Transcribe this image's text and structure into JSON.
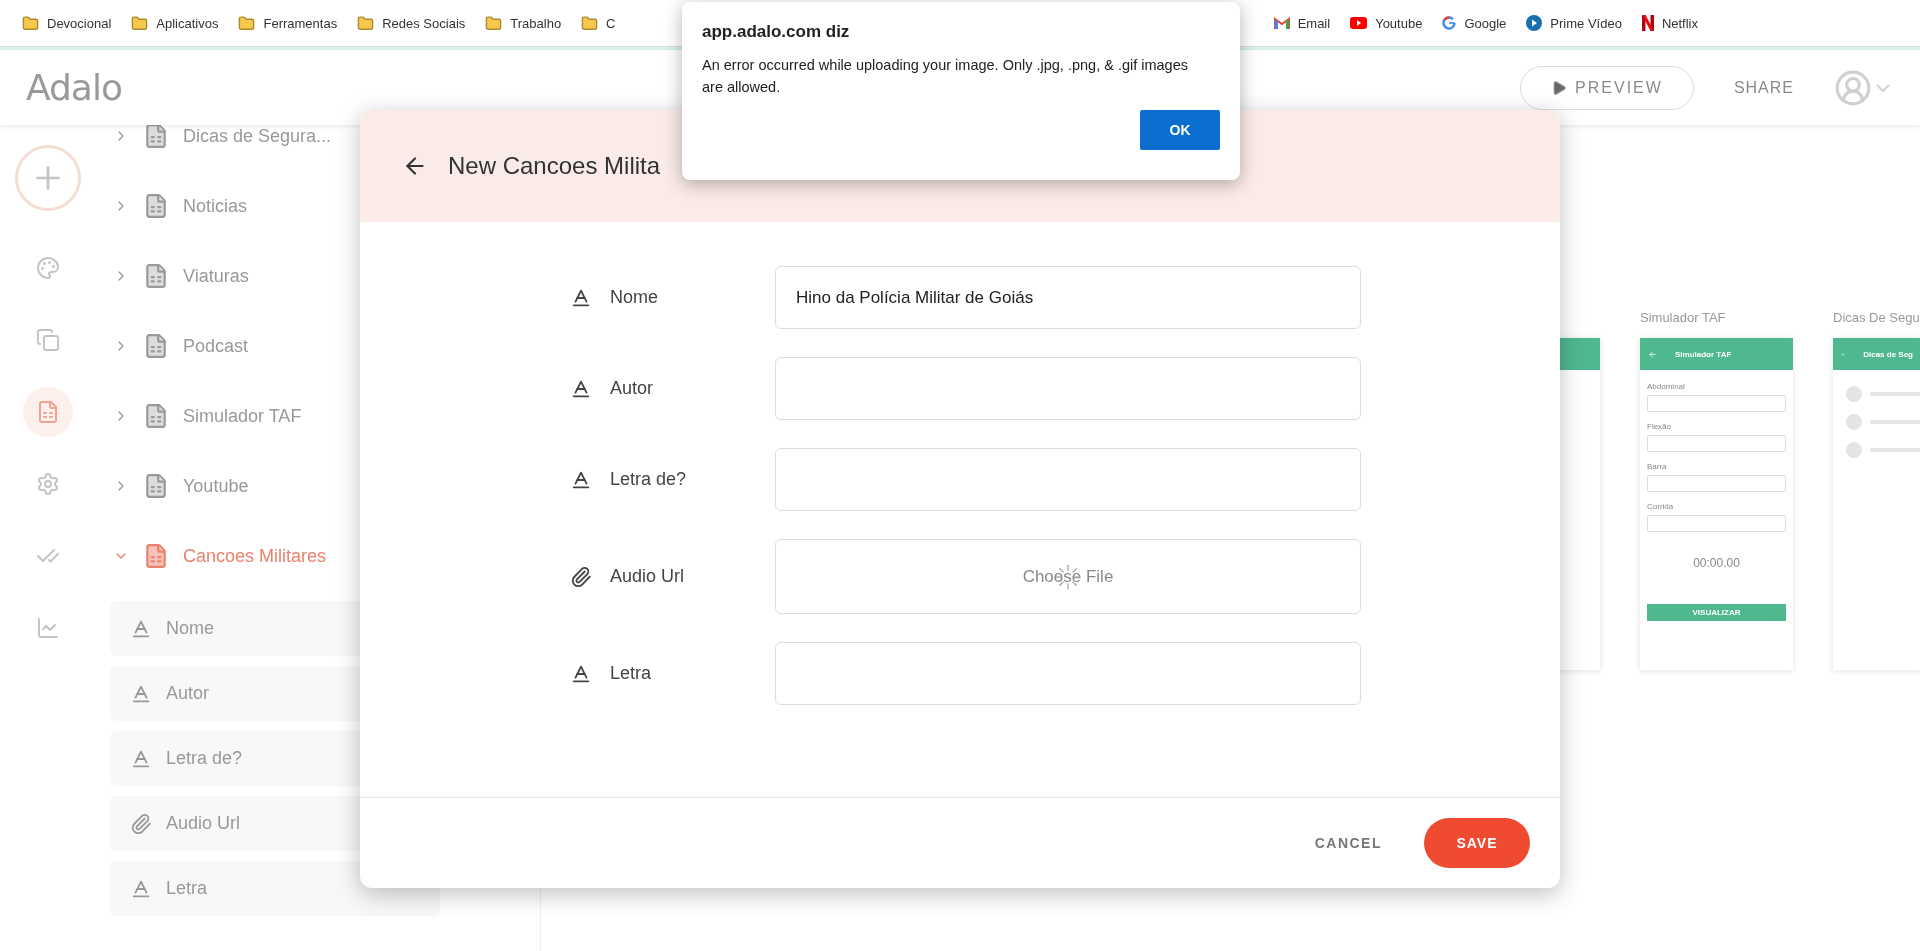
{
  "bookmarks": {
    "left": [
      {
        "label": "Devocional"
      },
      {
        "label": "Aplicativos"
      },
      {
        "label": "Ferramentas"
      },
      {
        "label": "Redes Sociais"
      },
      {
        "label": "Trabalho"
      },
      {
        "label": "C"
      }
    ],
    "right": [
      {
        "label": "Email",
        "kind": "gmail"
      },
      {
        "label": "Youtube",
        "kind": "youtube"
      },
      {
        "label": "Google",
        "kind": "google"
      },
      {
        "label": "Prime Vídeo",
        "kind": "prime"
      },
      {
        "label": "Netflix",
        "kind": "netflix"
      }
    ]
  },
  "app_header": {
    "logo": "Adalo",
    "preview": "PREVIEW",
    "share": "SHARE"
  },
  "rail": [
    {
      "kind": "add",
      "selected": false
    },
    {
      "kind": "palette",
      "selected": false
    },
    {
      "kind": "screens",
      "selected": false
    },
    {
      "kind": "database",
      "selected": true
    },
    {
      "kind": "settings",
      "selected": false
    },
    {
      "kind": "checks",
      "selected": false
    },
    {
      "kind": "analytics",
      "selected": false
    }
  ],
  "collections": [
    {
      "name": "Dicas de Segura...",
      "expanded": false
    },
    {
      "name": "Noticias",
      "expanded": false
    },
    {
      "name": "Viaturas",
      "expanded": false
    },
    {
      "name": "Podcast",
      "expanded": false
    },
    {
      "name": "Simulador TAF",
      "expanded": false
    },
    {
      "name": "Youtube",
      "expanded": false
    },
    {
      "name": "Cancoes Militares",
      "expanded": true,
      "children": [
        {
          "name": "Nome",
          "kind": "text"
        },
        {
          "name": "Autor",
          "kind": "text"
        },
        {
          "name": "Letra de?",
          "kind": "text"
        },
        {
          "name": "Audio Url",
          "kind": "file"
        },
        {
          "name": "Letra",
          "kind": "text"
        }
      ]
    }
  ],
  "canvas": {
    "screens": [
      {
        "kind": "blank"
      },
      {
        "kind": "form",
        "title": "Simulador TAF",
        "header": "Simulador TAF",
        "fields": [
          "Abdominal",
          "Flexão",
          "Barra",
          "Corrida"
        ],
        "timer": "00:00.00",
        "button": "VISUALIZAR"
      },
      {
        "kind": "list",
        "title": "Dicas De Segu",
        "header": "Dicas de Seg"
      }
    ]
  },
  "modal": {
    "title": "New Cancoes Milita",
    "fields": [
      {
        "label": "Nome",
        "kind": "text",
        "value": "Hino da Polícia Militar de Goiás"
      },
      {
        "label": "Autor",
        "kind": "text"
      },
      {
        "label": "Letra de?",
        "kind": "text"
      },
      {
        "label": "Audio Url",
        "kind": "file",
        "button": "Choose File",
        "loading": true
      },
      {
        "label": "Letra",
        "kind": "text"
      }
    ],
    "cancel": "CANCEL",
    "save": "SAVE"
  },
  "alert": {
    "title": "app.adalo.com diz",
    "message": "An error occurred while uploading your image. Only .jpg, .png, & .gif images are allowed.",
    "ok": "OK"
  }
}
